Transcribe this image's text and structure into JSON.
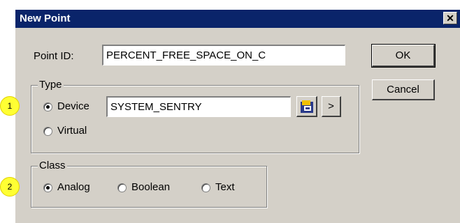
{
  "window": {
    "title": "New Point",
    "close_glyph": "✕"
  },
  "point_id": {
    "label": "Point ID:",
    "value": "PERCENT_FREE_SPACE_ON_C"
  },
  "buttons": {
    "ok": "OK",
    "cancel": "Cancel",
    "arrow": ">"
  },
  "type_group": {
    "legend": "Type",
    "device_label": "Device",
    "device_value": "SYSTEM_SENTRY",
    "virtual_label": "Virtual",
    "selected": "Device",
    "device_picker_icon": "device-browse-icon"
  },
  "class_group": {
    "legend": "Class",
    "options": [
      "Analog",
      "Boolean",
      "Text"
    ],
    "selected": "Analog"
  },
  "annotations": [
    {
      "number": "1",
      "color": "#ffff33"
    },
    {
      "number": "2",
      "color": "#ffff33"
    }
  ],
  "colors": {
    "titlebar": "#0a246a",
    "dialog": "#d4d0c8"
  }
}
